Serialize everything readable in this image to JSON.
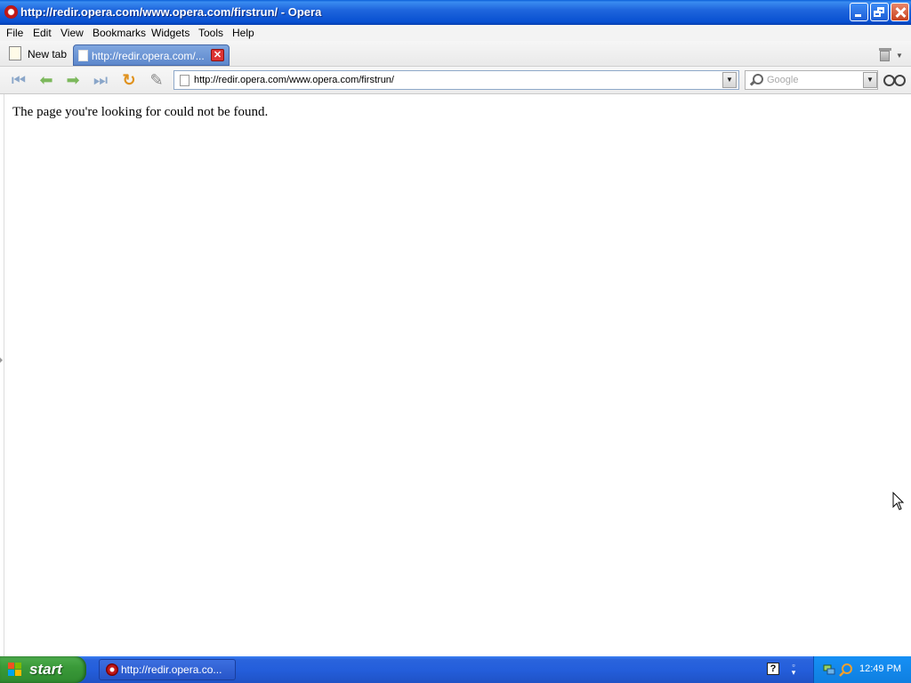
{
  "window": {
    "title": "http://redir.opera.com/www.opera.com/firstrun/ - Opera"
  },
  "menu": {
    "items": [
      "File",
      "Edit",
      "View",
      "Bookmarks",
      "Widgets",
      "Tools",
      "Help"
    ]
  },
  "tabs": {
    "new_tab_label": "New tab",
    "active_tab_label": "http://redir.opera.com/..."
  },
  "toolbar": {
    "address_value": "http://redir.opera.com/www.opera.com/firstrun/",
    "search_placeholder": "Google"
  },
  "content": {
    "message": "The page you're looking for could not be found."
  },
  "taskbar": {
    "start_label": "start",
    "task_label": "http://redir.opera.co...",
    "clock": "12:49 PM"
  },
  "colors": {
    "titlebar": "#0850d1",
    "start_button": "#3a9a39",
    "taskbar": "#245edb",
    "tray": "#0f7fe0"
  }
}
